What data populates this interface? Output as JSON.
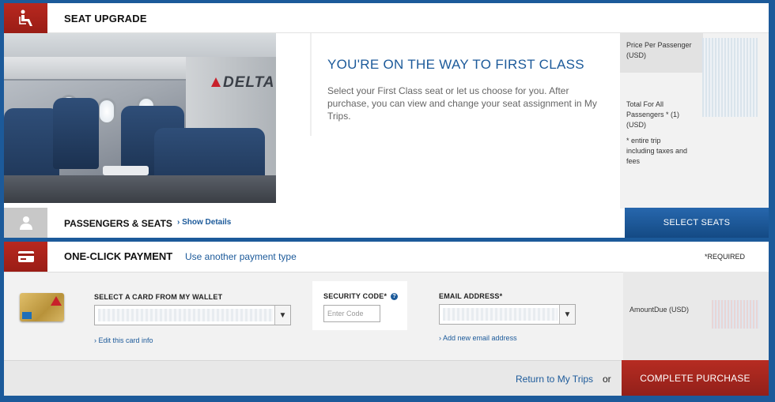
{
  "seat_upgrade": {
    "title": "SEAT UPGRADE",
    "image_logo_text": "DELTA",
    "promo_title": "YOU'RE ON THE WAY TO FIRST CLASS",
    "promo_text": "Select your First Class seat or let us choose for you. After purchase, you can view and change your seat assignment in My Trips.",
    "price_per_passenger_label": "Price Per Passenger (USD)",
    "total_label": "Total For All Passengers * (1) (USD)",
    "footnote": "* entire trip including taxes and fees"
  },
  "passengers": {
    "title": "PASSENGERS & SEATS",
    "show_details": "Show Details",
    "select_seats": "SELECT SEATS"
  },
  "payment": {
    "title": "ONE-CLICK PAYMENT",
    "alt_link": "Use another payment type",
    "required": "*REQUIRED",
    "card_label": "SELECT A CARD FROM MY WALLET",
    "edit_card": "Edit this card info",
    "security_label": "SECURITY CODE*",
    "security_placeholder": "Enter Code",
    "email_label": "EMAIL ADDRESS*",
    "add_email": "Add new email address",
    "amount_label": "AmountDue (USD)"
  },
  "footer": {
    "return_link": "Return to My Trips",
    "or": "or",
    "complete": "COMPLETE PURCHASE"
  },
  "colors": {
    "brand_blue": "#1c5a9a",
    "brand_red": "#a8231b",
    "page_bg": "#1c5a9a"
  },
  "icons": [
    "seat-icon",
    "person-icon",
    "credit-card-icon",
    "help-icon",
    "chevron-down-icon"
  ]
}
